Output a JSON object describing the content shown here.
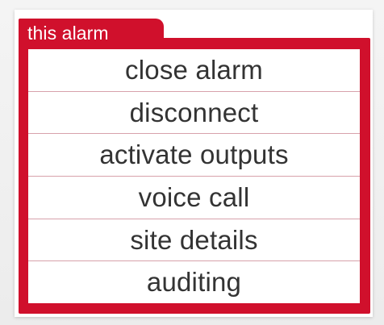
{
  "colors": {
    "accent": "#d0102c"
  },
  "alarm_menu": {
    "title": "this alarm",
    "items": [
      {
        "label": "close alarm"
      },
      {
        "label": "disconnect"
      },
      {
        "label": "activate outputs"
      },
      {
        "label": "voice call"
      },
      {
        "label": "site details"
      },
      {
        "label": "auditing"
      }
    ]
  }
}
